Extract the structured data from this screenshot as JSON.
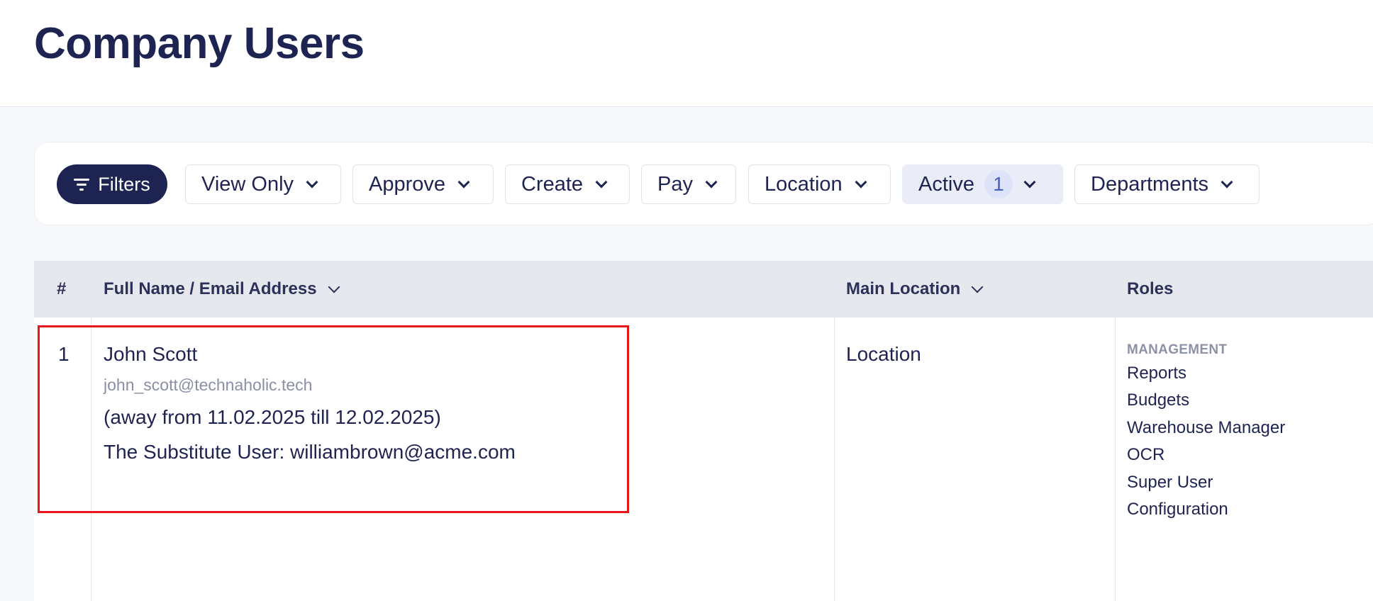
{
  "page": {
    "title": "Company Users"
  },
  "filters": {
    "filters_label": "Filters",
    "dropdowns": [
      {
        "label": "View Only"
      },
      {
        "label": "Approve"
      },
      {
        "label": "Create"
      },
      {
        "label": "Pay"
      },
      {
        "label": "Location"
      },
      {
        "label": "Active",
        "badge": "1"
      },
      {
        "label": "Departments"
      }
    ]
  },
  "table": {
    "columns": [
      "#",
      "Full Name / Email Address",
      "Main Location",
      "Roles"
    ],
    "rows": [
      {
        "number": "1",
        "name": "John Scott",
        "email": "john_scott@technaholic.tech",
        "away": "(away from 11.02.2025 till 12.02.2025)",
        "substitute": "The Substitute User: williambrown@acme.com",
        "location": "Location",
        "role_group": "MANAGEMENT",
        "roles": [
          "Reports",
          "Budgets",
          "Warehouse Manager",
          "OCR",
          "Super User",
          "Configuration"
        ]
      }
    ]
  },
  "colors": {
    "primary": "#1e2452",
    "highlight": "#e8151b",
    "active_filter_bg": "#eaedf8",
    "muted_text": "#8b8fa6"
  },
  "icons": {
    "filters": "filter-lines-icon",
    "dropdown": "chevron-down-icon"
  }
}
